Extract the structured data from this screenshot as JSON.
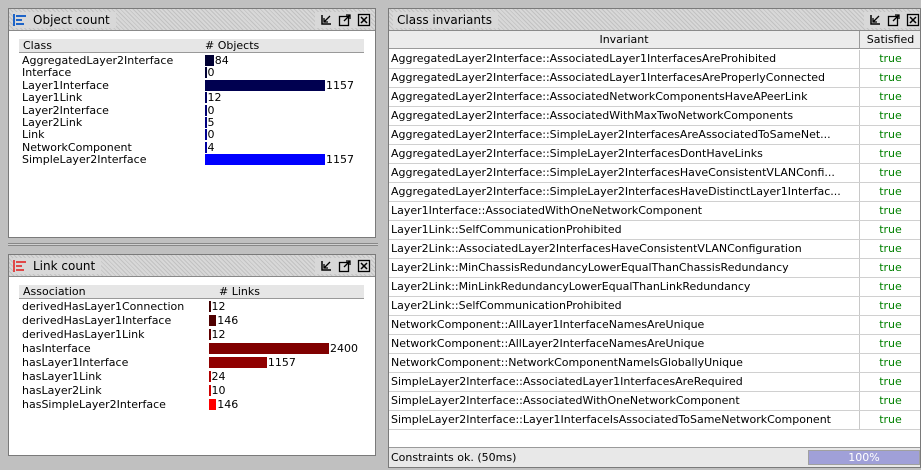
{
  "object_count": {
    "title": "Object count",
    "col_class": "Class",
    "col_objects": "# Objects",
    "rows": [
      {
        "label": "AggregatedLayer2Interface",
        "value": 84,
        "text": "84",
        "color": "#000033"
      },
      {
        "label": "Interface",
        "value": 0,
        "text": "0",
        "color": "#000033"
      },
      {
        "label": "Layer1Interface",
        "value": 1157,
        "text": "1157",
        "color": "#000050"
      },
      {
        "label": "Layer1Link",
        "value": 12,
        "text": "12",
        "color": "#000060"
      },
      {
        "label": "Layer2Interface",
        "value": 0,
        "text": "0",
        "color": "#000070"
      },
      {
        "label": "Layer2Link",
        "value": 5,
        "text": "5",
        "color": "#000080"
      },
      {
        "label": "Link",
        "value": 0,
        "text": "0",
        "color": "#000090"
      },
      {
        "label": "NetworkComponent",
        "value": 4,
        "text": "4",
        "color": "#0000a0"
      },
      {
        "label": "SimpleLayer2Interface",
        "value": 1157,
        "text": "1157",
        "color": "#0000ff"
      }
    ]
  },
  "link_count": {
    "title": "Link count",
    "col_assoc": "Association",
    "col_links": "# Links",
    "rows": [
      {
        "label": "derivedHasLayer1Connection",
        "value": 12,
        "text": "12",
        "color": "#400000"
      },
      {
        "label": "derivedHasLayer1Interface",
        "value": 146,
        "text": "146",
        "color": "#500000"
      },
      {
        "label": "derivedHasLayer1Link",
        "value": 12,
        "text": "12",
        "color": "#600000"
      },
      {
        "label": "hasInterface",
        "value": 2400,
        "text": "2400",
        "color": "#800000"
      },
      {
        "label": "hasLayer1Interface",
        "value": 1157,
        "text": "1157",
        "color": "#900000"
      },
      {
        "label": "hasLayer1Link",
        "value": 24,
        "text": "24",
        "color": "#b00000"
      },
      {
        "label": "hasLayer2Link",
        "value": 10,
        "text": "10",
        "color": "#d00000"
      },
      {
        "label": "hasSimpleLayer2Interface",
        "value": 146,
        "text": "146",
        "color": "#ff0000"
      }
    ]
  },
  "invariants": {
    "title": "Class invariants",
    "col_invariant": "Invariant",
    "col_satisfied": "Satisfied",
    "rows": [
      {
        "name": "AggregatedLayer2Interface::AssociatedLayer1InterfacesAreProhibited",
        "satisfied": "true"
      },
      {
        "name": "AggregatedLayer2Interface::AssociatedLayer1InterfacesAreProperlyConnected",
        "satisfied": "true"
      },
      {
        "name": "AggregatedLayer2Interface::AssociatedNetworkComponentsHaveAPeerLink",
        "satisfied": "true"
      },
      {
        "name": "AggregatedLayer2Interface::AssociatedWithMaxTwoNetworkComponents",
        "satisfied": "true"
      },
      {
        "name": "AggregatedLayer2Interface::SimpleLayer2InterfacesAreAssociatedToSameNet...",
        "satisfied": "true"
      },
      {
        "name": "AggregatedLayer2Interface::SimpleLayer2InterfacesDontHaveLinks",
        "satisfied": "true"
      },
      {
        "name": "AggregatedLayer2Interface::SimpleLayer2InterfacesHaveConsistentVLANConfi...",
        "satisfied": "true"
      },
      {
        "name": "AggregatedLayer2Interface::SimpleLayer2InterfacesHaveDistinctLayer1Interfac...",
        "satisfied": "true"
      },
      {
        "name": "Layer1Interface::AssociatedWithOneNetworkComponent",
        "satisfied": "true"
      },
      {
        "name": "Layer1Link::SelfCommunicationProhibited",
        "satisfied": "true"
      },
      {
        "name": "Layer2Link::AssociatedLayer2InterfacesHaveConsistentVLANConfiguration",
        "satisfied": "true"
      },
      {
        "name": "Layer2Link::MinChassisRedundancyLowerEqualThanChassisRedundancy",
        "satisfied": "true"
      },
      {
        "name": "Layer2Link::MinLinkRedundancyLowerEqualThanLinkRedundancy",
        "satisfied": "true"
      },
      {
        "name": "Layer2Link::SelfCommunicationProhibited",
        "satisfied": "true"
      },
      {
        "name": "NetworkComponent::AllLayer1InterfaceNamesAreUnique",
        "satisfied": "true"
      },
      {
        "name": "NetworkComponent::AllLayer2InterfaceNamesAreUnique",
        "satisfied": "true"
      },
      {
        "name": "NetworkComponent::NetworkComponentNameIsGloballyUnique",
        "satisfied": "true"
      },
      {
        "name": "SimpleLayer2Interface::AssociatedLayer1InterfacesAreRequired",
        "satisfied": "true"
      },
      {
        "name": "SimpleLayer2Interface::AssociatedWithOneNetworkComponent",
        "satisfied": "true"
      },
      {
        "name": "SimpleLayer2Interface::Layer1InterfaceIsAssociatedToSameNetworkComponent",
        "satisfied": "true"
      }
    ],
    "status": "Constraints ok. (50ms)",
    "progress_label": "100%",
    "progress_fraction": 1.0
  },
  "icons": {
    "panel": "bar-chart-icon",
    "restore": "restore-icon",
    "maximize": "maximize-icon",
    "close": "close-icon"
  },
  "colors": {
    "icon_blue": "#1e64c8",
    "icon_red": "#e04848",
    "true_green": "#008000"
  }
}
